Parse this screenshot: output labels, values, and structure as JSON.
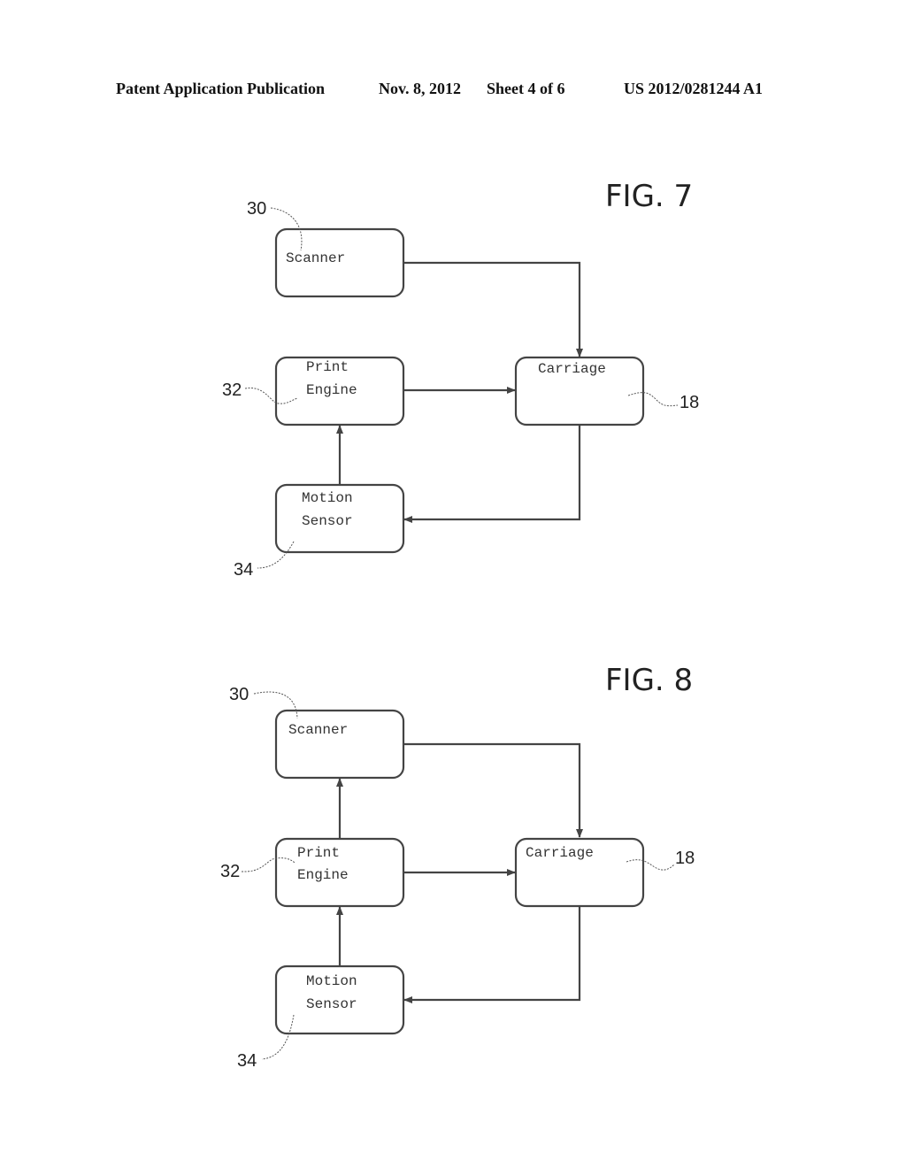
{
  "header": {
    "publication": "Patent Application Publication",
    "date": "Nov. 8, 2012",
    "sheet": "Sheet 4 of 6",
    "number": "US 2012/0281244 A1"
  },
  "figures": [
    {
      "label": "FIG. 7",
      "blocks": {
        "scanner": {
          "lines": [
            "Scanner"
          ],
          "ref": "30"
        },
        "print_engine": {
          "lines": [
            "Print",
            "Engine"
          ],
          "ref": "32"
        },
        "carriage": {
          "lines": [
            "Carriage"
          ],
          "ref": "18"
        },
        "motion_sensor": {
          "lines": [
            "Motion",
            "Sensor"
          ],
          "ref": "34"
        }
      },
      "connections": [
        {
          "from": "scanner",
          "to": "carriage"
        },
        {
          "from": "print_engine",
          "to": "carriage"
        },
        {
          "from": "carriage",
          "to": "motion_sensor"
        },
        {
          "from": "motion_sensor",
          "to": "print_engine"
        }
      ]
    },
    {
      "label": "FIG. 8",
      "blocks": {
        "scanner": {
          "lines": [
            "Scanner"
          ],
          "ref": "30"
        },
        "print_engine": {
          "lines": [
            "Print",
            "Engine"
          ],
          "ref": "32"
        },
        "carriage": {
          "lines": [
            "Carriage"
          ],
          "ref": "18"
        },
        "motion_sensor": {
          "lines": [
            "Motion",
            "Sensor"
          ],
          "ref": "34"
        }
      },
      "connections": [
        {
          "from": "scanner",
          "to": "carriage"
        },
        {
          "from": "print_engine",
          "to": "carriage"
        },
        {
          "from": "print_engine",
          "to": "scanner"
        },
        {
          "from": "carriage",
          "to": "motion_sensor"
        },
        {
          "from": "motion_sensor",
          "to": "print_engine"
        }
      ]
    }
  ]
}
